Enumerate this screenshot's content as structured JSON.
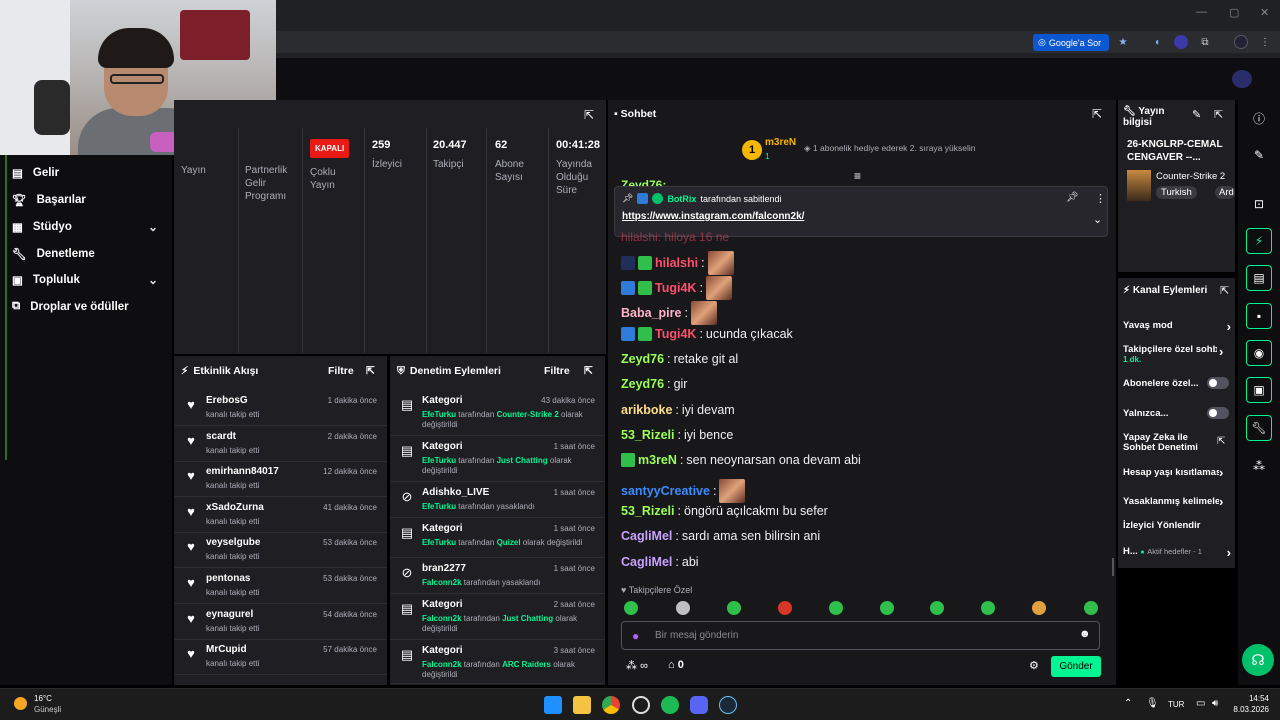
{
  "browser": {
    "ask_google_label": "Google'a Sor"
  },
  "sidebar": {
    "items": [
      {
        "label": "Gelir"
      },
      {
        "label": "Başarılar"
      },
      {
        "label": "Stüdyo"
      },
      {
        "label": "Denetleme"
      },
      {
        "label": "Topluluk"
      },
      {
        "label": "Droplar ve ödüller"
      }
    ]
  },
  "stats": {
    "yayin": "Yayın",
    "partner": "Partnerlik Gelir Programı",
    "coklu_badge": "KAPALI",
    "coklu": "Çoklu Yayın",
    "viewers_value": "259",
    "viewers_label": "İzleyici",
    "followers_value": "20.447",
    "followers_label": "Takipçi",
    "subs_value": "62",
    "subs_label": "Abone Sayısı",
    "uptime_value": "00:41:28",
    "uptime_label": "Yayında Olduğu Süre"
  },
  "activity": {
    "title": "Etkinlik Akışı",
    "filter": "Filtre",
    "rows": [
      {
        "name": "ErebosG",
        "sub": "kanalı takip etti",
        "time": "1 dakika önce"
      },
      {
        "name": "scardt",
        "sub": "kanalı takip etti",
        "time": "2 dakika önce"
      },
      {
        "name": "emirhann84017",
        "sub": "kanalı takip etti",
        "time": "12 dakika önce"
      },
      {
        "name": "xSadoZurna",
        "sub": "kanalı takip etti",
        "time": "41 dakika önce"
      },
      {
        "name": "veyselgube",
        "sub": "kanalı takip etti",
        "time": "53 dakika önce"
      },
      {
        "name": "pentonas",
        "sub": "kanalı takip etti",
        "time": "53 dakika önce"
      },
      {
        "name": "eynagurel",
        "sub": "kanalı takip etti",
        "time": "54 dakika önce"
      },
      {
        "name": "MrCupid",
        "sub": "kanalı takip etti",
        "time": "57 dakika önce"
      }
    ]
  },
  "moderation": {
    "title": "Denetim Eylemleri",
    "filter": "Filtre",
    "rows": [
      {
        "name": "Kategori",
        "who": "EfeTurku",
        "mid": " tarafından ",
        "target": "Counter-Strike 2",
        "end": " olarak değiştirildi",
        "time": "43 dakika önce"
      },
      {
        "name": "Kategori",
        "who": "EfeTurku",
        "mid": " tarafından ",
        "target": "Just Chatting",
        "end": " olarak değiştirildi",
        "time": "1 saat önce"
      },
      {
        "name": "Adishko_LIVE",
        "who": "EfeTurku",
        "mid": " tarafından yasaklandı",
        "target": "",
        "end": "",
        "time": "1 saat önce"
      },
      {
        "name": "Kategori",
        "who": "EfeTurku",
        "mid": " tarafından ",
        "target": "Quizel",
        "end": " olarak değiştirildi",
        "time": "1 saat önce"
      },
      {
        "name": "bran2277",
        "who": "Falconn2k",
        "mid": " tarafından yasaklandı",
        "target": "",
        "end": "",
        "time": "1 saat önce"
      },
      {
        "name": "Kategori",
        "who": "Falconn2k",
        "mid": " tarafından ",
        "target": "Just Chatting",
        "end": " olarak değiştirildi",
        "time": "2 saat önce"
      },
      {
        "name": "Kategori",
        "who": "Falconn2k",
        "mid": " tarafından ",
        "target": "ARC Raiders",
        "end": " olarak değiştirildi",
        "time": "3 saat önce"
      }
    ]
  },
  "chat": {
    "title": "Sohbet",
    "gift_user": "m3reN",
    "gift_count": "1",
    "gift_rank": "1",
    "gift_text": "1 abonelik hediye ederek 2. sıraya yükselin",
    "partial_top": "Zeyd76:",
    "pin_by": "BotRix",
    "pin_text": "tarafından sabitlendi",
    "pin_link": "https://www.instagram.com/falconn2k/",
    "partial_msg": "hilalshi: hiloya 16 ne",
    "messages": [
      {
        "user": "hilalshi",
        "color": "#ff4f6d",
        "text": ""
      },
      {
        "user": "Tugi4K",
        "color": "#ff4f6d",
        "text": ""
      },
      {
        "user": "Baba_pire",
        "color": "#ffb3c7",
        "text": ""
      },
      {
        "user": "Tugi4K",
        "color": "#ff4f6d",
        "text": "ucunda çıkacak"
      },
      {
        "user": "Zeyd76",
        "color": "#9bff5a",
        "text": "retake git al"
      },
      {
        "user": "Zeyd76",
        "color": "#9bff5a",
        "text": "gir"
      },
      {
        "user": "arikboke",
        "color": "#ffdf8a",
        "text": "iyi devam"
      },
      {
        "user": "53_Rizeli",
        "color": "#9bff5a",
        "text": "iyi bence"
      },
      {
        "user": "m3reN",
        "color": "#9bff5a",
        "text": "sen neoynarsan ona devam abi"
      },
      {
        "user": "santyyCreative",
        "color": "#3a8bff",
        "text": ""
      },
      {
        "user": "53_Rizeli",
        "color": "#9bff5a",
        "text": "öngörü açılcakmı bu sefer"
      },
      {
        "user": "CagliMel",
        "color": "#c8a0ff",
        "text": "sardı ama sen bilirsin ani"
      },
      {
        "user": "CagliMel",
        "color": "#c8a0ff",
        "text": "abi"
      }
    ],
    "followers_only": "Takipçilere Özel",
    "input_placeholder": "Bir mesaj gönderin",
    "points": "∞",
    "shop_count": "0",
    "send": "Gönder"
  },
  "stream_info": {
    "title": "Yayın bilgisi",
    "stream_title": "26-KNGLRP-CEMAL CENGAVER --...",
    "category": "Counter-Strike 2",
    "tags": [
      "Turkish",
      "Ard"
    ]
  },
  "channel_actions": {
    "title": "Kanal Eylemleri",
    "items": [
      "Yavaş mod",
      "Takipçilere özel sohbet",
      "Abonelere özel...",
      "Yalnızca...",
      "Yapay Zeka ile Sohbet Denetimi",
      "Hesap yaşı kısıtlaması",
      "Yasaklanmış kelimeler",
      "İzleyici Yönlendir",
      "H..."
    ],
    "follower_sub": "1 dk.",
    "active_goals": "Aktif hedefler - 1"
  },
  "taskbar": {
    "weather_temp": "16°C",
    "weather_desc": "Güneşli",
    "lang": "TUR",
    "time": "14:54",
    "date": "8.03.2026"
  },
  "colors": {
    "accent": "#00f593",
    "live_red": "#e91916",
    "panel": "#1f1f23"
  }
}
